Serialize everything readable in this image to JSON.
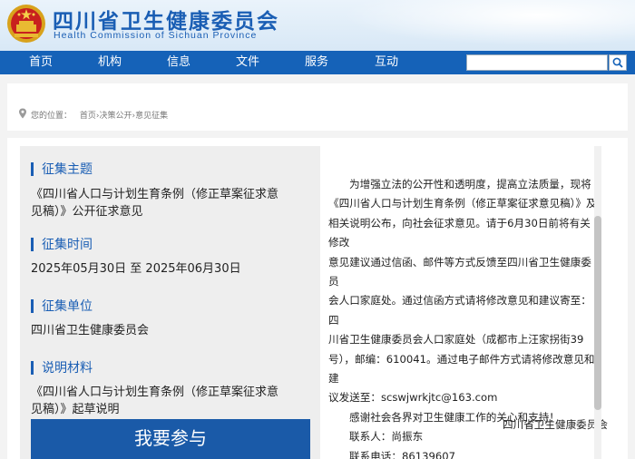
{
  "header": {
    "title": "四川省卫生健康委员会",
    "subtitle": "Health Commission of Sichuan Province"
  },
  "nav": {
    "items": [
      "首页",
      "机构",
      "信息",
      "文件",
      "服务",
      "互动"
    ],
    "search_placeholder": ""
  },
  "breadcrumb": {
    "prefix": "您的位置：",
    "path": "首页›决策公开›意见征集"
  },
  "solicitation": {
    "topic_heading": "征集主题",
    "topic": "《四川省人口与计划生育条例（修正草案征求意见稿）》公开征求意见",
    "time_heading": "征集时间",
    "time": "2025年05月30日 至 2025年06月30日",
    "unit_heading": "征集单位",
    "unit": "四川省卫生健康委员会",
    "material_heading": "说明材料",
    "material": "《四川省人口与计划生育条例（修正草案征求意见稿）》起草说明",
    "join_button": "我要参与"
  },
  "notice": {
    "paragraph_lines": [
      "为增强立法的公开性和透明度，提高立法质量，现将",
      "《四川省人口与计划生育条例（修正草案征求意见稿）》及",
      "相关说明公布，向社会征求意见。请于6月30日前将有关修改",
      "意见建议通过信函、邮件等方式反馈至四川省卫生健康委员",
      "会人口家庭处。通过信函方式请将修改意见和建议寄至：四",
      "川省卫生健康委员会人口家庭处（成都市上汪家拐街39",
      "号），邮编：610041。通过电子邮件方式请将修改意见和建",
      "议发送至：scswjwrkjtc@163.com"
    ],
    "thanks": "感谢社会各界对卫生健康工作的关心和支持！",
    "contact": "联系人：尚振东",
    "phone": "联系电话：86139607",
    "signature": "四川省卫生健康委员会"
  },
  "colors": {
    "brand_blue": "#1a5eb4",
    "nav_blue": "#1562b8",
    "button_blue": "#1a5aa8"
  }
}
